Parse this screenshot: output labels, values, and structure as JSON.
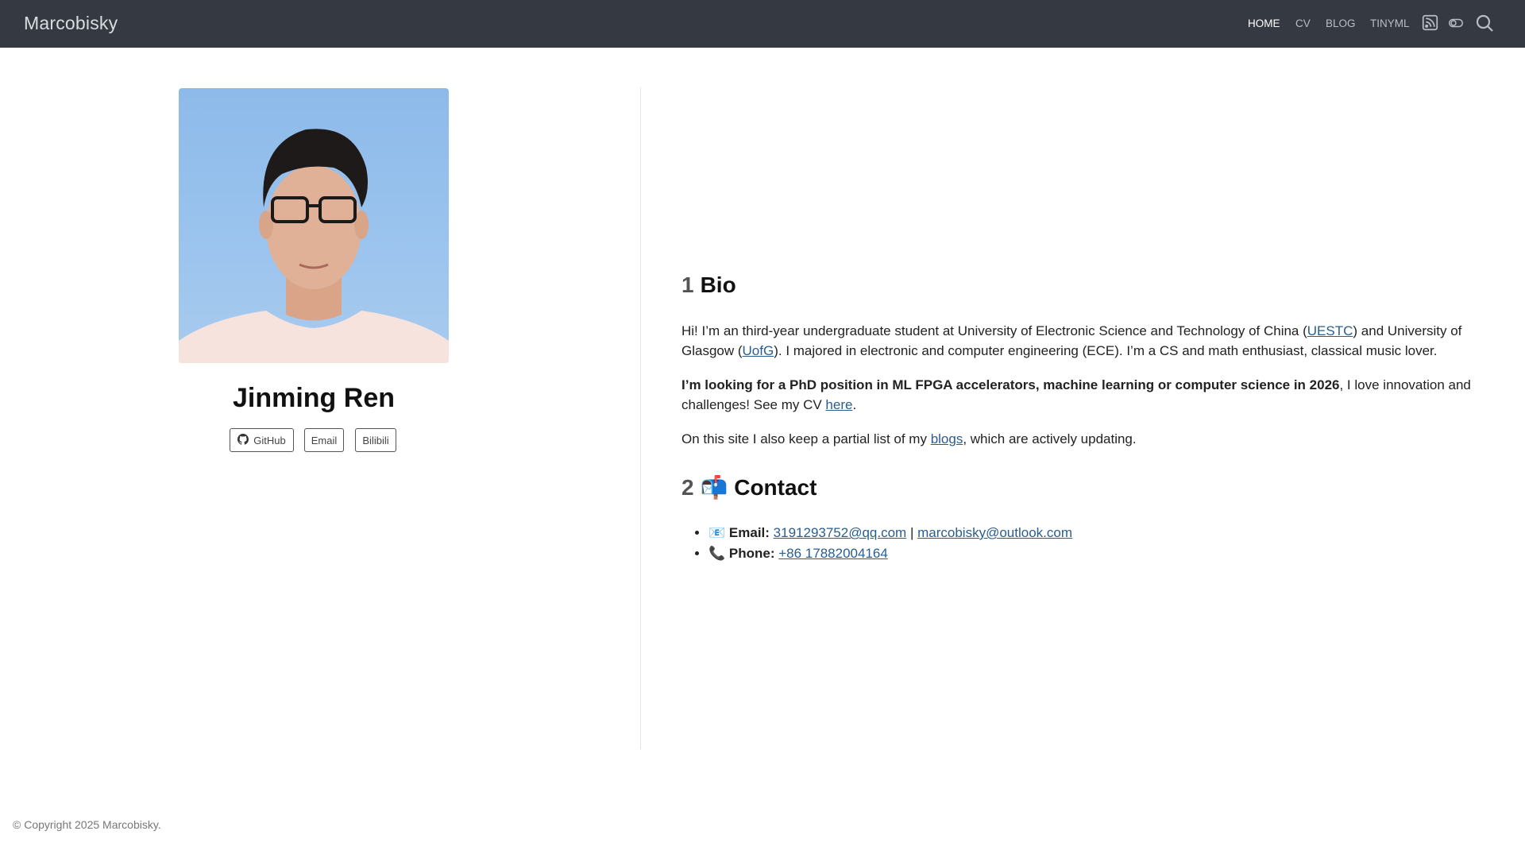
{
  "navbar": {
    "brand": "Marcobisky",
    "links": [
      "HOME",
      "CV",
      "BLOG",
      "TINYML"
    ],
    "icons": [
      "rss-icon",
      "theme-toggle-icon",
      "search-icon"
    ]
  },
  "profile": {
    "name": "Jinming Ren",
    "buttons": [
      "GitHub",
      "Email",
      "Bilibili"
    ]
  },
  "bio": {
    "number": "1",
    "heading": "Bio",
    "p1_a": "Hi! I’m an third-year undergraduate student at University of Electronic Science and Technology of China (",
    "p1_link1": "UESTC",
    "p1_b": ") and University of Glasgow (",
    "p1_link2": "UofG",
    "p1_c": "). I majored in electronic and computer engineering (ECE). I’m a CS and math enthusiast, classical music lover.",
    "p2_bold": "I’m looking for a PhD position in ML FPGA accelerators, machine learning or computer science in 2026",
    "p2_a": ", I love innovation and challenges! See my CV ",
    "p2_link": "here",
    "p2_b": ".",
    "p3_a": "On this site I also keep a partial list of my ",
    "p3_link": "blogs",
    "p3_b": ", which are actively updating."
  },
  "contact": {
    "number": "2",
    "emoji": "📬",
    "heading": "Contact",
    "email_emoji": "📧",
    "email_label": "Email:",
    "email1": "3191293752@qq.com",
    "separator": "|",
    "email2": "marcobisky@outlook.com",
    "phone_emoji": "📞",
    "phone_label": "Phone:",
    "phone": "+86 17882004164"
  },
  "footer": {
    "text": "© Copyright 2025 Marcobisky."
  }
}
